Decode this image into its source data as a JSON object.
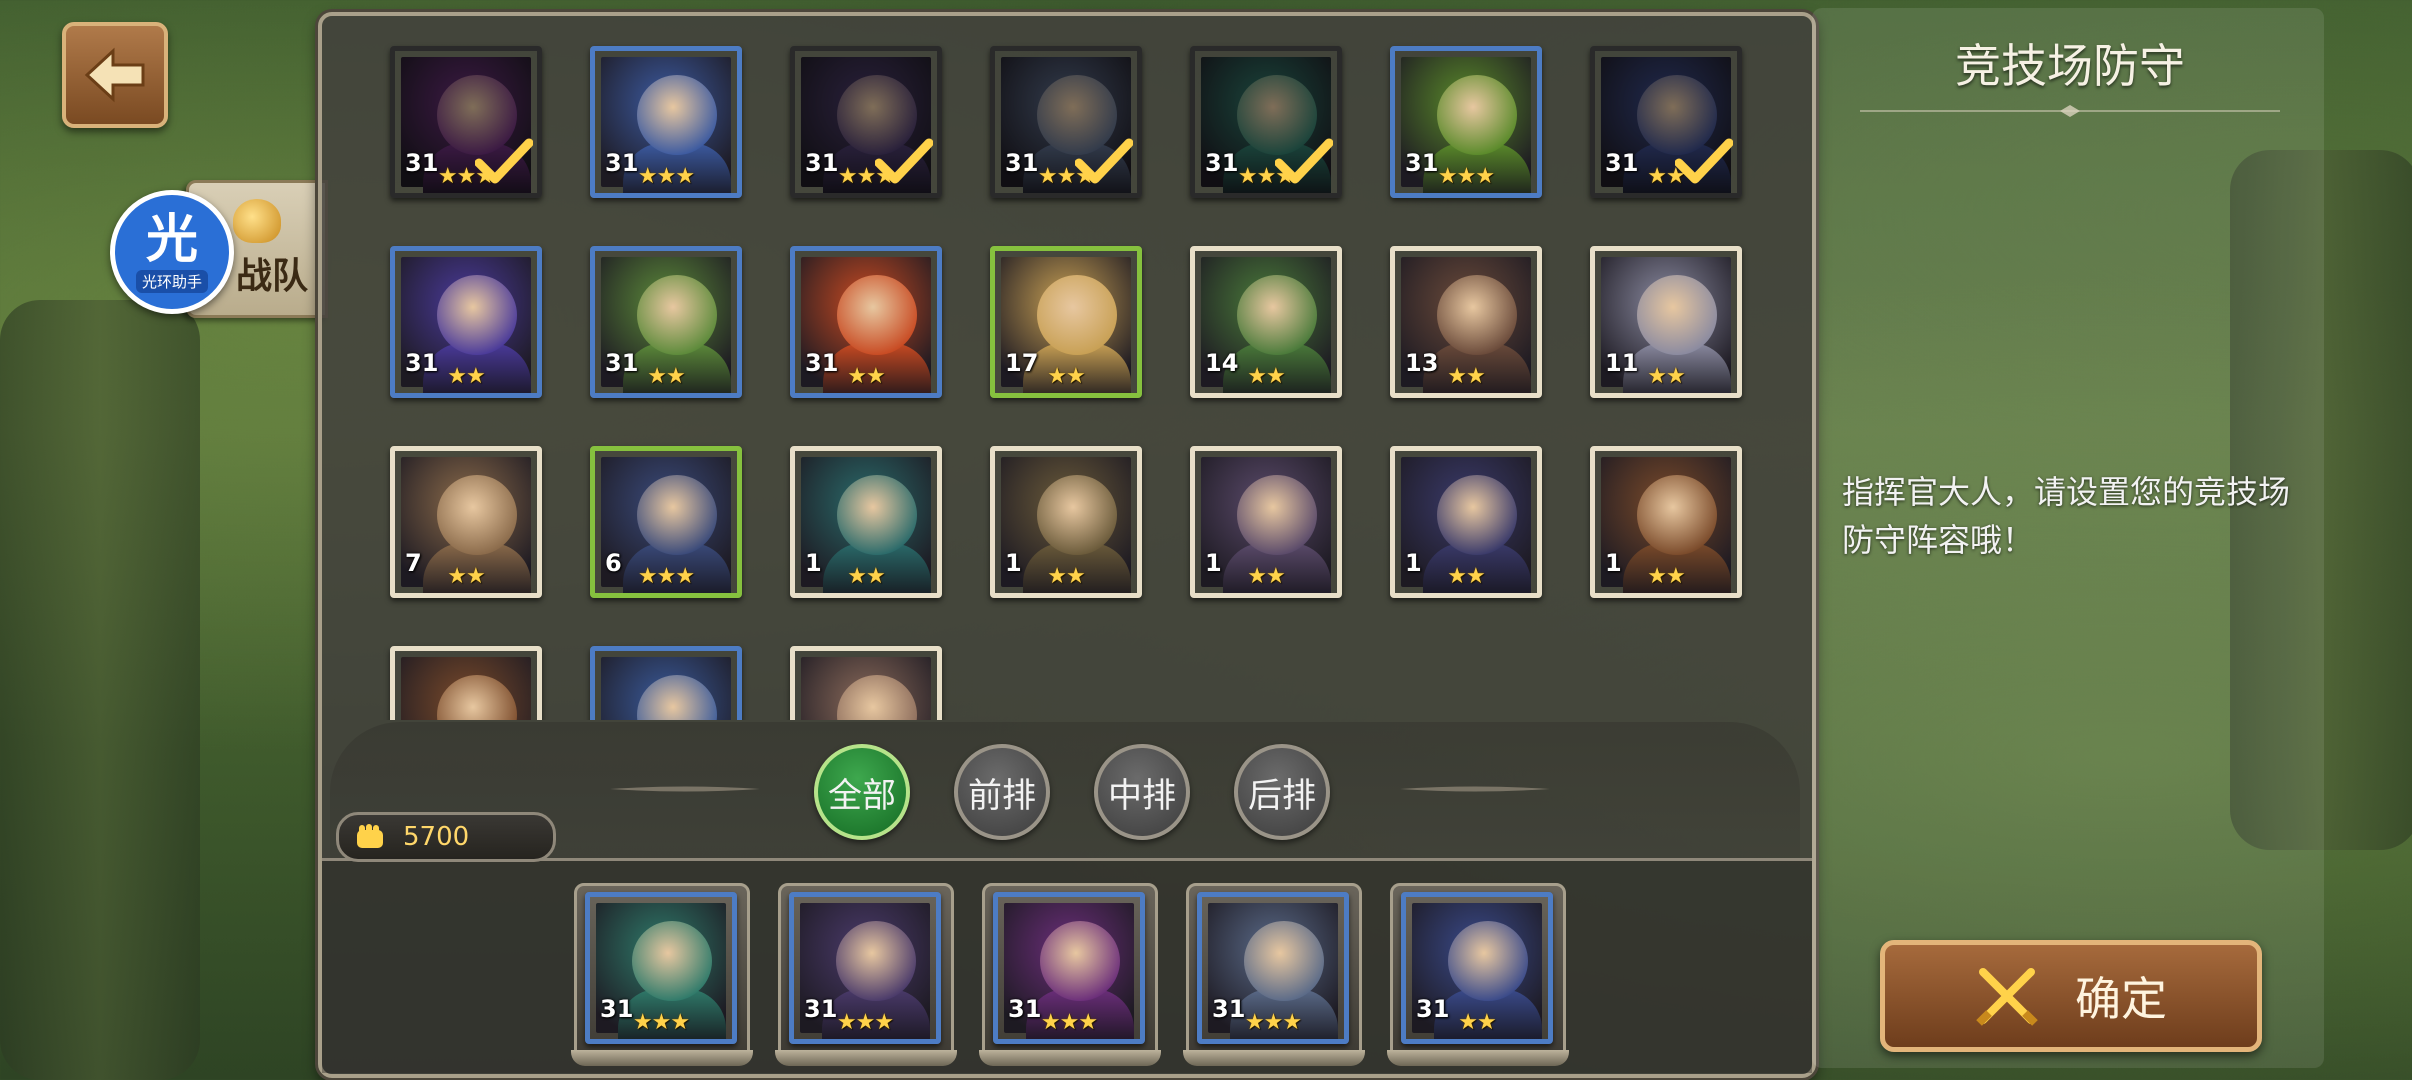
{
  "nav": {
    "back_icon": "back-arrow-icon"
  },
  "helper": {
    "glyph": "光",
    "label": "光环助手"
  },
  "team_tab": {
    "label": "战队",
    "icon": "helmet-icon"
  },
  "panel": {
    "title": "竞技场防守",
    "desc": "指挥官大人，请设置您的竞技场防守阵容哦！"
  },
  "filters": [
    {
      "label": "全部",
      "active": true
    },
    {
      "label": "前排",
      "active": false
    },
    {
      "label": "中排",
      "active": false
    },
    {
      "label": "后排",
      "active": false
    }
  ],
  "power": {
    "value": "5700",
    "icon": "fist-icon"
  },
  "confirm": {
    "label": "确定",
    "icon": "crossed-swords-icon"
  },
  "heroes": [
    {
      "level": "31",
      "stars": 3,
      "frame": "dark",
      "selected": true,
      "color": "#6b2e7a"
    },
    {
      "level": "31",
      "stars": 3,
      "frame": "blue",
      "selected": false,
      "color": "#3c5aa0"
    },
    {
      "level": "31",
      "stars": 3,
      "frame": "dark",
      "selected": true,
      "color": "#4a3a6a"
    },
    {
      "level": "31",
      "stars": 3,
      "frame": "dark",
      "selected": true,
      "color": "#5a6a88"
    },
    {
      "level": "31",
      "stars": 3,
      "frame": "dark",
      "selected": true,
      "color": "#2f7a6a"
    },
    {
      "level": "31",
      "stars": 3,
      "frame": "blue",
      "selected": false,
      "color": "#5a8a2a"
    },
    {
      "level": "31",
      "stars": 2,
      "frame": "dark",
      "selected": true,
      "color": "#3a4a8a"
    },
    {
      "level": "31",
      "stars": 2,
      "frame": "blue",
      "selected": false,
      "color": "#4a3a9a"
    },
    {
      "level": "31",
      "stars": 2,
      "frame": "blue",
      "selected": false,
      "color": "#5c8a3a"
    },
    {
      "level": "31",
      "stars": 2,
      "frame": "blue",
      "selected": false,
      "color": "#c84a22"
    },
    {
      "level": "17",
      "stars": 2,
      "frame": "green",
      "selected": false,
      "color": "#c8a054"
    },
    {
      "level": "14",
      "stars": 2,
      "frame": "white",
      "selected": false,
      "color": "#4a7a3a"
    },
    {
      "level": "13",
      "stars": 2,
      "frame": "white",
      "selected": false,
      "color": "#6a4a3a"
    },
    {
      "level": "11",
      "stars": 2,
      "frame": "white",
      "selected": false,
      "color": "#8a8aa0"
    },
    {
      "level": "7",
      "stars": 2,
      "frame": "white",
      "selected": false,
      "color": "#8a6a4a"
    },
    {
      "level": "6",
      "stars": 3,
      "frame": "green",
      "selected": false,
      "color": "#3a4a7a"
    },
    {
      "level": "1",
      "stars": 2,
      "frame": "white",
      "selected": false,
      "color": "#2a6a6a"
    },
    {
      "level": "1",
      "stars": 2,
      "frame": "white",
      "selected": false,
      "color": "#6a5a3a"
    },
    {
      "level": "1",
      "stars": 2,
      "frame": "white",
      "selected": false,
      "color": "#5a4a6a"
    },
    {
      "level": "1",
      "stars": 2,
      "frame": "white",
      "selected": false,
      "color": "#3a3a6a"
    },
    {
      "level": "1",
      "stars": 2,
      "frame": "white",
      "selected": false,
      "color": "#7a4a2a"
    },
    {
      "level": "",
      "stars": 0,
      "frame": "white",
      "selected": false,
      "color": "#7a4a2a"
    },
    {
      "level": "",
      "stars": 0,
      "frame": "blue",
      "selected": false,
      "color": "#3a5a9a"
    },
    {
      "level": "",
      "stars": 0,
      "frame": "white",
      "selected": false,
      "color": "#8a6a5a"
    }
  ],
  "lineup": [
    {
      "level": "31",
      "stars": 3,
      "color": "#2f7a6a"
    },
    {
      "level": "31",
      "stars": 3,
      "color": "#4a3a6a"
    },
    {
      "level": "31",
      "stars": 3,
      "color": "#6b2e7a"
    },
    {
      "level": "31",
      "stars": 3,
      "color": "#5a6a88"
    },
    {
      "level": "31",
      "stars": 2,
      "color": "#3a4a8a"
    }
  ]
}
